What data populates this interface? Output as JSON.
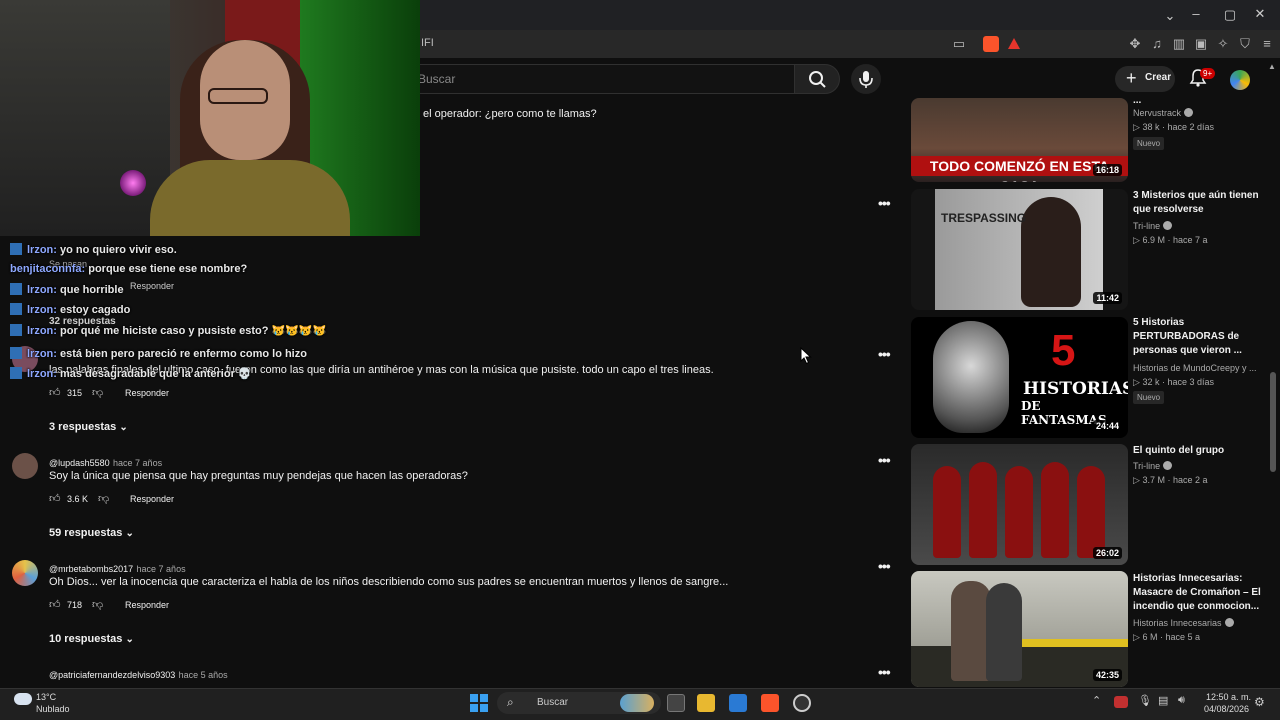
{
  "browser": {
    "url_fragment": "IFI",
    "window_controls": [
      "chevron-down",
      "minimize",
      "maximize",
      "close"
    ]
  },
  "yt_header": {
    "search_placeholder": "Buscar",
    "create_label": "Crear",
    "notification_count": "9+"
  },
  "chat": [
    {
      "user": "lrzon:",
      "msg": "yo no quiero vivir eso."
    },
    {
      "user": "benjitaconnfa:",
      "msg": "porque ese tiene ese nombre?"
    },
    {
      "user": "lrzon:",
      "msg": "que horrible"
    },
    {
      "user": "lrzon:",
      "msg": "estoy cagado"
    },
    {
      "user": "lrzon:",
      "msg": "por qué me hiciste caso y pusiste esto? 😿😿😿😿"
    },
    {
      "user": "lrzon:",
      "msg": "está bien pero pareció re enfermo como lo hizo"
    },
    {
      "user": "lrzon:",
      "msg": "mas desagradable que la anterior 💀"
    }
  ],
  "comments": {
    "top_snippet": "el operador: ¿pero como te llamas?",
    "ghost_lines": [
      "Se pasan",
      "Responder",
      "32 respuestas"
    ],
    "c1": {
      "text": "las palabras finales del ultimo caso, fueron como las que diría un antihéroe y mas con la música que pusiste. todo un capo el tres lineas.",
      "likes": "315",
      "reply": "Responder",
      "replies": "3 respuestas"
    },
    "c2": {
      "handle": "@lupdash5580",
      "time": "hace 7 años",
      "text": "Soy la única que piensa que hay preguntas muy pendejas que hacen las operadoras?",
      "likes": "3.6 K",
      "reply": "Responder",
      "replies": "59 respuestas"
    },
    "c3": {
      "handle": "@mrbetabombs2017",
      "time": "hace 7 años",
      "text": "Oh Dios... ver la inocencia que caracteriza el habla de los niños describiendo como sus padres se encuentran muertos y llenos de sangre...",
      "likes": "718",
      "reply": "Responder",
      "replies": "10 respuestas"
    },
    "c4": {
      "handle": "@patriciafernandezdelviso9303",
      "time": "hace 5 años"
    }
  },
  "videos": [
    {
      "title": "...",
      "channel": "Nervustrack",
      "views": "38 k",
      "age": "hace 2 días",
      "badge": "Nuevo",
      "duration": "16:18",
      "thumb_caption": "TODO COMENZÓ EN ESTA CASA"
    },
    {
      "title": "3 Misterios que aún tienen que resolverse",
      "channel": "Tri-line",
      "views": "6.9 M",
      "age": "hace 7 a",
      "duration": "11:42",
      "thumb_caption": "TRESPASSING"
    },
    {
      "title": "5 Historias PERTURBADORAS de personas que vieron ...",
      "channel": "Historias de MundoCreepy y ...",
      "views": "32 k",
      "age": "hace 3 días",
      "badge": "Nuevo",
      "duration": "24:44",
      "thumb_caption_num": "5",
      "thumb_caption_l1": "HISTORIAS",
      "thumb_caption_l2": "DE FANTASMAS"
    },
    {
      "title": "El quinto del grupo",
      "channel": "Tri-line",
      "views": "3.7 M",
      "age": "hace 2 a",
      "duration": "26:02"
    },
    {
      "title": "Historias Innecesarias: Masacre de Cromañon – El incendio que conmocion...",
      "channel": "Historias Innecesarias",
      "views": "6 M",
      "age": "hace 5 a",
      "duration": "42:35"
    }
  ],
  "taskbar": {
    "temperature": "13°C",
    "weather": "Nublado",
    "search_label": "Buscar",
    "time": "12:50 a. m.",
    "date": "04/08/2026"
  },
  "colors": {
    "background": "#0f0f0f",
    "chat_user": "#8ea8ff",
    "accent_red": "#cc0000"
  }
}
